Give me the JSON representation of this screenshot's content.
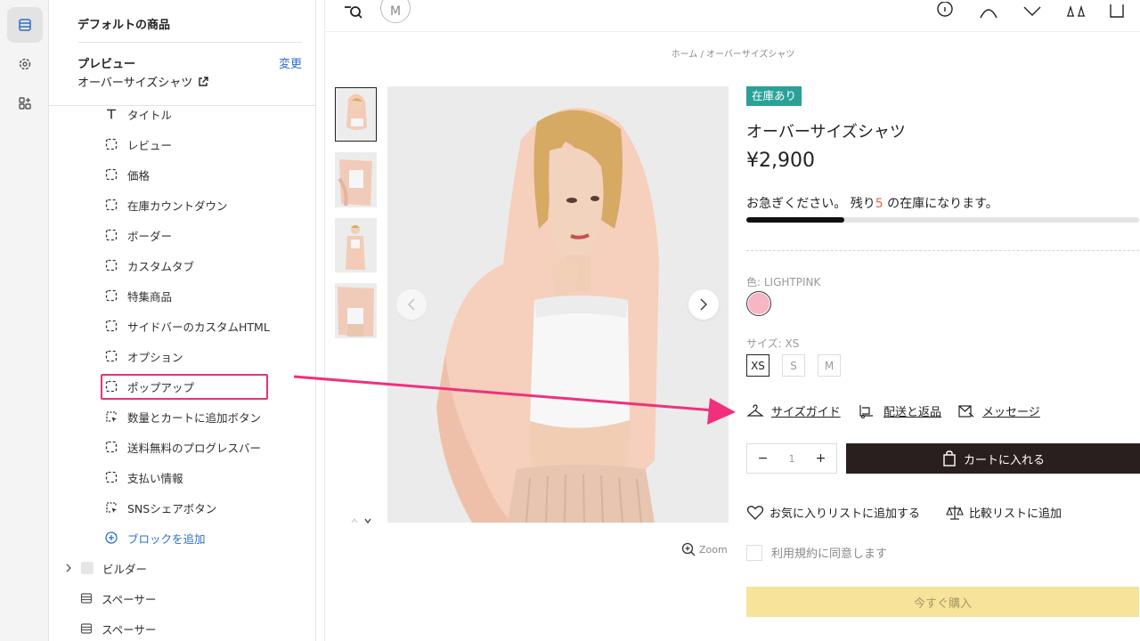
{
  "panel": {
    "title": "デフォルトの商品",
    "preview_label": "プレビュー",
    "change_link": "変更",
    "preview_product": "オーバーサイズシャツ",
    "blocks": [
      {
        "label": "タイトル",
        "icon": "text-icon"
      },
      {
        "label": "レビュー",
        "icon": "block-icon"
      },
      {
        "label": "価格",
        "icon": "block-icon"
      },
      {
        "label": "在庫カウントダウン",
        "icon": "block-icon"
      },
      {
        "label": "ボーダー",
        "icon": "block-icon"
      },
      {
        "label": "カスタムタブ",
        "icon": "block-icon"
      },
      {
        "label": "特集商品",
        "icon": "block-icon"
      },
      {
        "label": "サイドバーのカスタムHTML",
        "icon": "block-icon"
      },
      {
        "label": "オプション",
        "icon": "block-icon"
      },
      {
        "label": "ポップアップ",
        "icon": "block-icon"
      },
      {
        "label": "数量とカートに追加ボタン",
        "icon": "cursor-block-icon"
      },
      {
        "label": "送料無料のプログレスバー",
        "icon": "block-icon"
      },
      {
        "label": "支払い情報",
        "icon": "block-icon"
      },
      {
        "label": "SNSシェアボタン",
        "icon": "cursor-block-icon"
      }
    ],
    "add_block": "ブロックを追加",
    "sections": [
      {
        "label": "ビルダー",
        "icon": "section-icon"
      },
      {
        "label": "スペーサー",
        "icon": "spacer-icon"
      },
      {
        "label": "スペーサー",
        "icon": "spacer-icon"
      }
    ]
  },
  "store": {
    "breadcrumb": "ホーム / オーバーサイズシャツ",
    "logo_letter": "M",
    "zoom_label": "Zoom",
    "product": {
      "stock_badge": "在庫あり",
      "name": "オーバーサイズシャツ",
      "price": "¥2,900",
      "urgency_prefix": "お急ぎください。 残り",
      "urgency_count": "5",
      "urgency_suffix": " の在庫になります。",
      "stock_progress": 0.25,
      "color_label": "色: LIGHTPINK",
      "color_value": "#f7b6c3",
      "size_label": "サイズ: XS",
      "sizes": [
        "XS",
        "S",
        "M"
      ],
      "selected_size": "XS",
      "links": {
        "size_guide": "サイズガイド",
        "shipping": "配送と返品",
        "message": "メッセージ"
      },
      "quantity": {
        "minus": "−",
        "value": "1",
        "plus": "+"
      },
      "add_to_cart": "カートに入れる",
      "wishlist": "お気に入りリストに追加する",
      "compare": "比較リストに追加",
      "terms": "利用規約に同意します",
      "buy_now": "今すぐ購入"
    }
  },
  "colors": {
    "accent_blue": "#2c6ecb",
    "highlight_pink": "#e8317a",
    "stock_green": "#2aa198",
    "cart_dark": "#2a1f1f",
    "buy_yellow": "#f7e49a"
  }
}
